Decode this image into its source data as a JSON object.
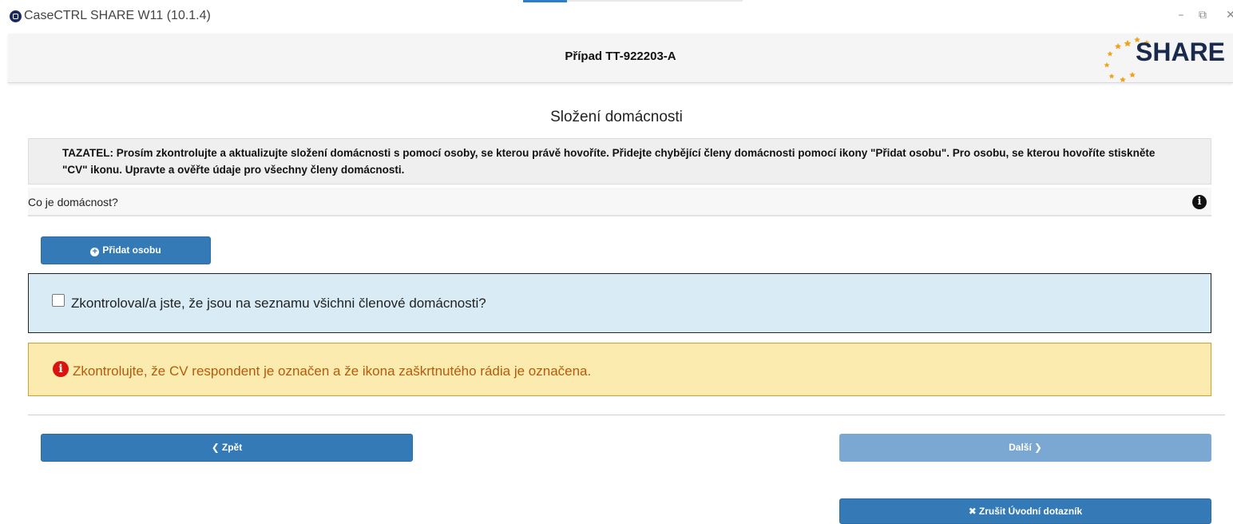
{
  "window": {
    "title": "CaseCTRL SHARE W11 (10.1.4)",
    "controls": {
      "minimize": "–",
      "restore": "⧉",
      "close": "✕"
    }
  },
  "header": {
    "case_title": "Případ TT-922203-A",
    "logo_text": "SHARE"
  },
  "page": {
    "title": "Složení domácnosti",
    "instruction": "TAZATEL: Prosím zkontrolujte a aktualizujte složení domácnosti s pomocí osoby, se kterou právě hovoříte. Přidejte chybějící členy domácnosti pomocí ikony \"Přidat osobu\". Pro osobu, se kterou hovoříte stiskněte \"CV\" ikonu. Upravte a ověřte údaje pro všechny členy domácnosti.",
    "what_is_household": "Co je domácnost?"
  },
  "buttons": {
    "add_person": "Přidat osobu",
    "back": "Zpět",
    "next": "Další",
    "cancel": "Zrušit Úvodní dotazník"
  },
  "checkbox": {
    "label": "Zkontroloval/a jste, že jsou na seznamu všichni členové domácnosti?",
    "checked": false
  },
  "warning": {
    "text": "Zkontrolujte, že CV respondent je označen a že ikona zaškrtnutého rádia je označena."
  },
  "colors": {
    "primary_button": "#337ab7",
    "disabled_button": "#7aa8d3",
    "info_panel": "#d9ecf5",
    "warning_panel": "#fbebae",
    "warning_text": "#b55a0a",
    "warning_icon": "#d9130f"
  }
}
